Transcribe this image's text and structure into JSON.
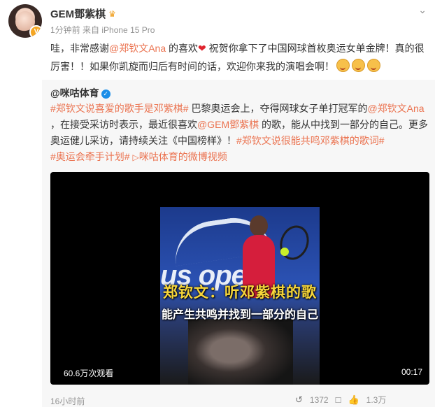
{
  "author": {
    "name": "GEM鄧紫棋",
    "time": "1分钟前",
    "source": "来自 iPhone 15 Pro",
    "verified_badge": "V"
  },
  "post_text": {
    "part1": "哇，非常感谢",
    "mention": "@郑钦文Ana",
    "part2": " 的喜欢",
    "part3": " 祝贺你拿下了中国网球首枚奥运女单金牌！真的很厉害！！如果你凯旋而归后有时间的话，欢迎你来我的演唱会啊！"
  },
  "repost": {
    "source": "@咪咕体育",
    "tag1": "#郑钦文说喜爱的歌手是邓紫棋#",
    "text1": " 巴黎奥运会上，夺得网球女子单打冠军的",
    "mention1": "@郑钦文Ana",
    "text2": " ，在接受采访时表示，最近很喜欢",
    "mention2": "@GEM鄧紫棋",
    "text3": " 的歌，能从中找到一部分的自己。更多奥运健儿采访，请持续关注《中国榜样》！",
    "tag2": "#郑钦文说很能共鸣邓紫棋的歌词#",
    "tag3": "#奥运会牵手计划#",
    "video_link": "咪咕体育的微博视频",
    "video": {
      "caption_main": "郑钦文：听邓紫棋的歌",
      "caption_sub": "能产生共鸣并找到一部分的自己",
      "banner_text": "us open",
      "views": "60.6万次观看",
      "duration": "00:17"
    },
    "time": "16小时前",
    "reposts": "1372",
    "likes": "1.3万"
  },
  "icons": {
    "more": "chevron-down-icon",
    "crown": "crown-icon",
    "heart": "heart-icon",
    "verify": "verified-check-icon",
    "video": "video-icon",
    "repost": "repost-icon",
    "comment": "comment-icon",
    "like": "like-icon"
  },
  "colors": {
    "mention": "#eb7350",
    "meta": "#939393",
    "repost_bg": "#f7f7f7",
    "verify_blue": "#1a8ee8"
  }
}
